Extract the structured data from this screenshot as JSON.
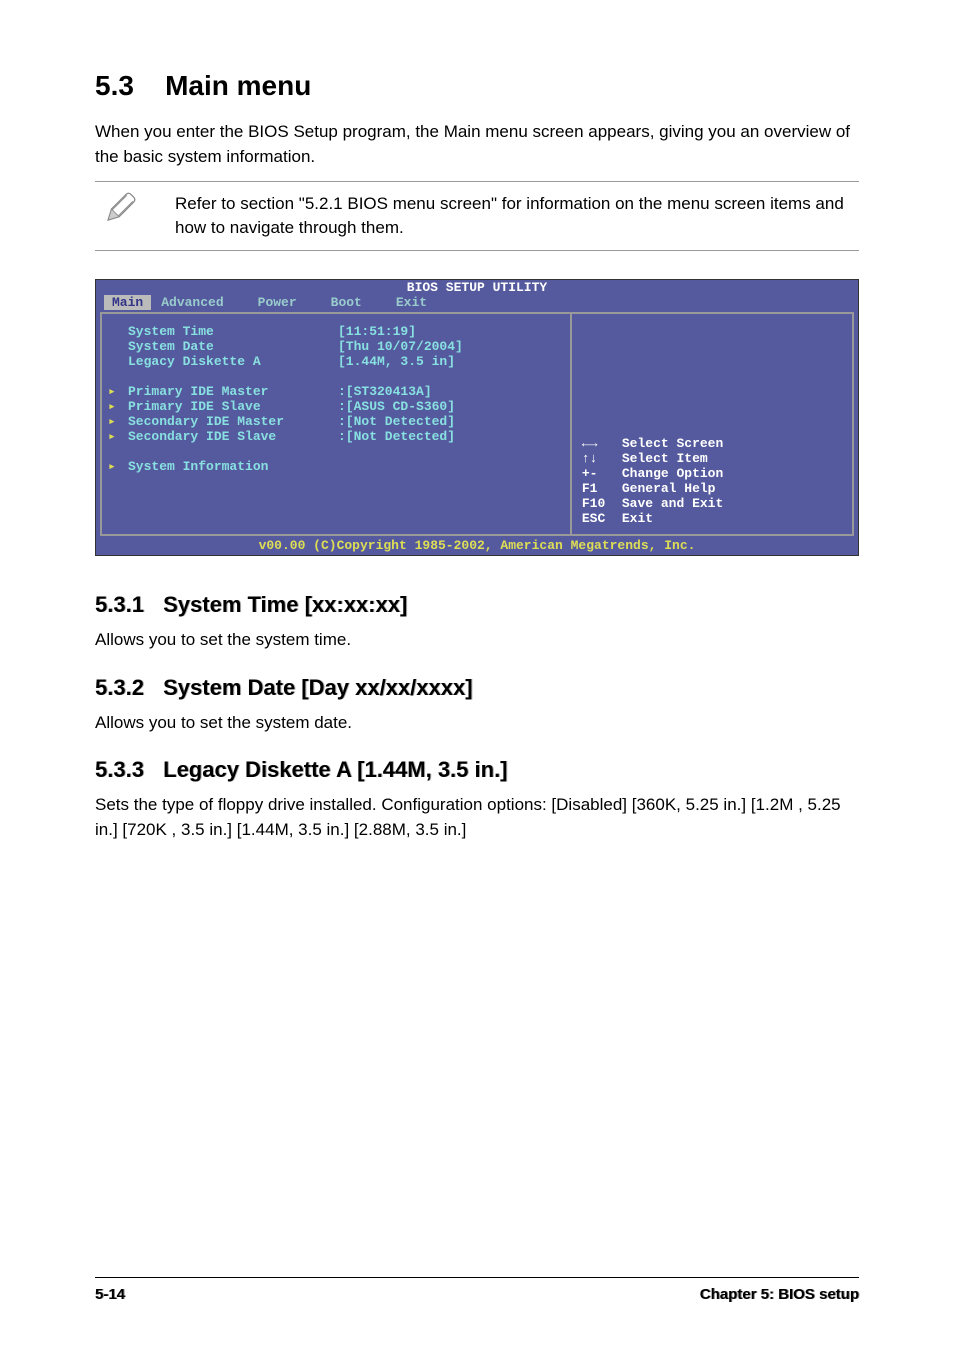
{
  "section": {
    "number": "5.3",
    "title": "Main menu",
    "intro": "When you enter the BIOS Setup program, the Main menu screen appears, giving you an overview of the basic system information."
  },
  "note": {
    "text": "Refer to section \"5.2.1  BIOS menu screen\" for information on the menu screen items and how to navigate through them."
  },
  "bios": {
    "title": "BIOS SETUP UTILITY",
    "tabs": {
      "t0": "Main",
      "t1": "Advanced",
      "t2": "Power",
      "t3": "Boot",
      "t4": "Exit"
    },
    "rows": {
      "r0": {
        "label": "System Time",
        "value": "[11:51:19]"
      },
      "r1": {
        "label": "System Date",
        "value": "[Thu 10/07/2004]"
      },
      "r2": {
        "label": "Legacy Diskette A",
        "value": "[1.44M, 3.5 in]"
      },
      "r3": {
        "label": "Primary IDE Master",
        "value": ":[ST320413A]"
      },
      "r4": {
        "label": "Primary IDE Slave",
        "value": ":[ASUS CD-S360]"
      },
      "r5": {
        "label": "Secondary IDE Master",
        "value": ":[Not Detected]"
      },
      "r6": {
        "label": "Secondary IDE Slave",
        "value": ":[Not Detected]"
      },
      "r7": {
        "label": "System Information",
        "value": ""
      }
    },
    "help": {
      "h0": {
        "key": "←→",
        "text": "Select Screen"
      },
      "h1": {
        "key": "↑↓",
        "text": "Select Item"
      },
      "h2": {
        "key": "+-",
        "text": "Change Option"
      },
      "h3": {
        "key": "F1",
        "text": "General Help"
      },
      "h4": {
        "key": "F10",
        "text": "Save and Exit"
      },
      "h5": {
        "key": "ESC",
        "text": "Exit"
      }
    },
    "footer": "v00.00 (C)Copyright 1985-2002, American Megatrends, Inc."
  },
  "subsections": {
    "s1": {
      "num": "5.3.1",
      "title": "System Time [xx:xx:xx]",
      "body": "Allows you to set the system time."
    },
    "s2": {
      "num": "5.3.2",
      "title": "System Date [Day xx/xx/xxxx]",
      "body": "Allows you to set the system date."
    },
    "s3": {
      "num": "5.3.3",
      "title": "Legacy Diskette A [1.44M, 3.5 in.]",
      "body": "Sets the type of floppy drive installed. Configuration options: [Disabled] [360K, 5.25 in.] [1.2M , 5.25 in.] [720K , 3.5 in.] [1.44M, 3.5 in.] [2.88M, 3.5 in.]"
    }
  },
  "footer": {
    "page": "5-14",
    "chapter": "Chapter 5: BIOS setup"
  }
}
